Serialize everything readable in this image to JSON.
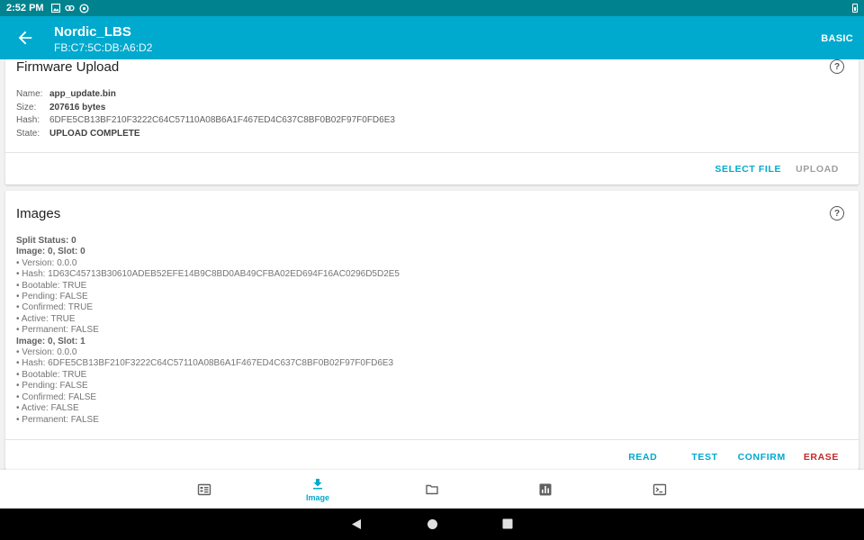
{
  "status_bar": {
    "time": "2:52 PM"
  },
  "app_bar": {
    "title": "Nordic_LBS",
    "subtitle": "FB:C7:5C:DB:A6:D2",
    "mode_button": "BASIC"
  },
  "firmware_upload": {
    "title": "Firmware Upload",
    "fields": [
      {
        "label": "Name:",
        "value": "app_update.bin"
      },
      {
        "label": "Size:",
        "value": "207616 bytes"
      },
      {
        "label": "Hash:",
        "value": "6DFE5CB13BF210F3222C64C57110A08B6A1F467ED4C637C8BF0B02F97F0FD6E3"
      },
      {
        "label": "State:",
        "value": "UPLOAD COMPLETE"
      }
    ],
    "select_file": "SELECT FILE",
    "upload": "UPLOAD"
  },
  "images": {
    "title": "Images",
    "split_status": "Split Status: 0",
    "slot0": {
      "header": "Image: 0, Slot: 0",
      "lines": [
        "• Version: 0.0.0",
        "• Hash: 1D63C45713B30610ADEB52EFE14B9C8BD0AB49CFBA02ED694F16AC0296D5D2E5",
        "• Bootable: TRUE",
        "• Pending: FALSE",
        "• Confirmed: TRUE",
        "• Active: TRUE",
        "• Permanent: FALSE"
      ]
    },
    "slot1": {
      "header": "Image: 0, Slot: 1",
      "lines": [
        "• Version: 0.0.0",
        "• Hash: 6DFE5CB13BF210F3222C64C57110A08B6A1F467ED4C637C8BF0B02F97F0FD6E3",
        "• Bootable: TRUE",
        "• Pending: FALSE",
        "• Confirmed: FALSE",
        "• Active: FALSE",
        "• Permanent: FALSE"
      ]
    },
    "read": "READ",
    "test": "TEST",
    "confirm": "CONFIRM",
    "erase": "ERASE"
  },
  "bottom_nav": {
    "items": [
      {
        "icon": "device-info-icon"
      },
      {
        "icon": "download-icon",
        "label": "Image"
      },
      {
        "icon": "folder-icon"
      },
      {
        "icon": "stats-icon"
      },
      {
        "icon": "terminal-icon"
      }
    ]
  },
  "colors": {
    "accent": "#00a9ce",
    "status_bar": "#00838f",
    "danger": "#c62828"
  }
}
